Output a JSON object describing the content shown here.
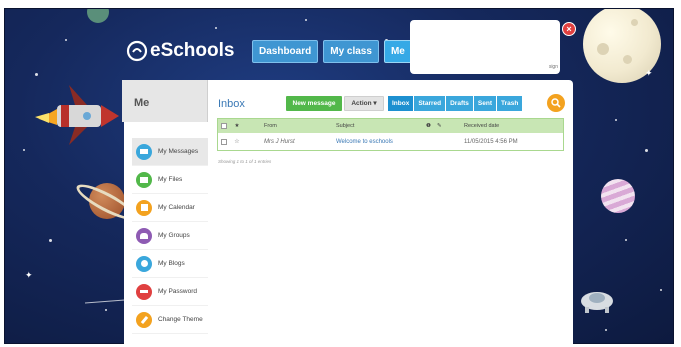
{
  "brand": {
    "name": "eSchools"
  },
  "top_nav": {
    "items": [
      "Dashboard",
      "My class",
      "Me"
    ],
    "active": "Me"
  },
  "popup": {
    "text": "sign"
  },
  "close_glyph": "×",
  "panel": {
    "title": "Me",
    "inbox_title": "Inbox",
    "new_message_label": "New message",
    "action_label": "Action ▾",
    "tabs": [
      "Inbox",
      "Starred",
      "Drafts",
      "Sent",
      "Trash"
    ],
    "active_tab": "Inbox"
  },
  "sidebar": {
    "items": [
      {
        "label": "My Messages",
        "icon": "envelope-icon",
        "color": "#3aa7dc",
        "active": true
      },
      {
        "label": "My Files",
        "icon": "folder-icon",
        "color": "#52b84a",
        "active": false
      },
      {
        "label": "My Calendar",
        "icon": "calendar-icon",
        "color": "#f3a21f",
        "active": false
      },
      {
        "label": "My Groups",
        "icon": "group-icon",
        "color": "#8e5bb3",
        "active": false
      },
      {
        "label": "My Blogs",
        "icon": "blog-icon",
        "color": "#3aa7dc",
        "active": false
      },
      {
        "label": "My Password",
        "icon": "key-icon",
        "color": "#e04040",
        "active": false
      },
      {
        "label": "Change Theme",
        "icon": "brush-icon",
        "color": "#f3a21f",
        "active": false
      }
    ]
  },
  "table": {
    "headers": {
      "from": "From",
      "subject": "Subject",
      "received": "Received date"
    },
    "rows": [
      {
        "from": "Mrs J Hurst",
        "subject": "Welcome to eschools",
        "date": "11/05/2015 4:56 PM"
      }
    ],
    "showing": "Showing 1 to 1 of 1 entries"
  },
  "colors": {
    "accent_blue": "#3aa7dc",
    "new_green": "#52b84a",
    "search_orange": "#f3a21f",
    "close_red": "#e04040"
  }
}
